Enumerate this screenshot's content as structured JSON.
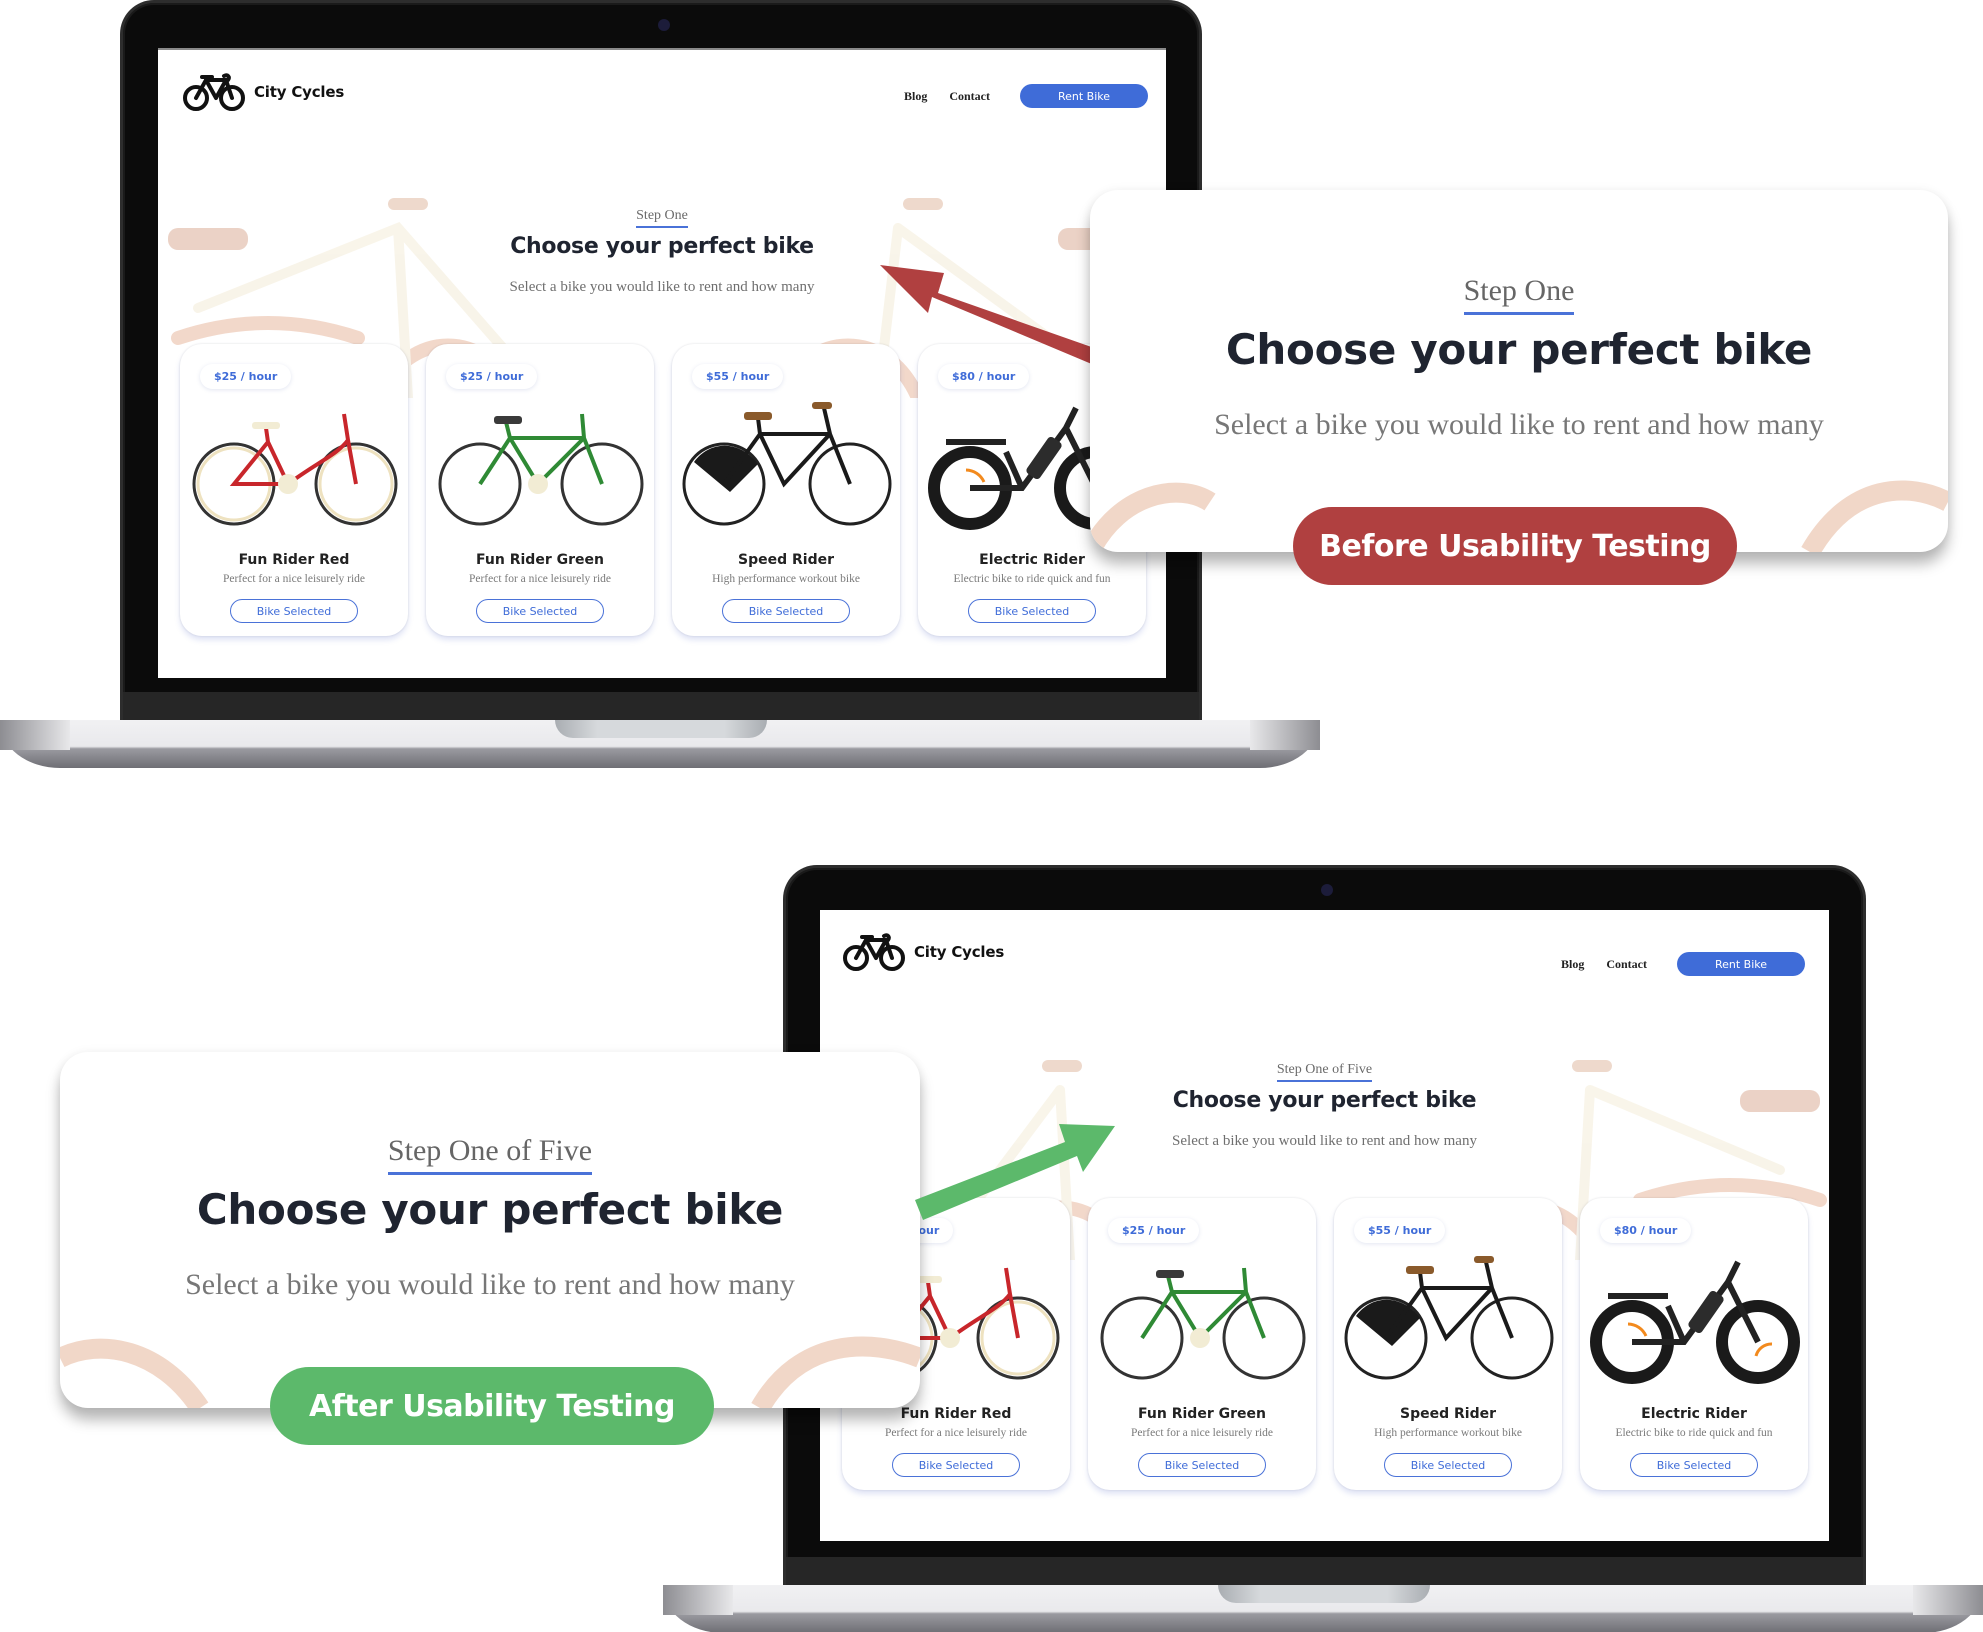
{
  "colors": {
    "brand_blue": "#3f6cd8",
    "before_red": "#b04040",
    "after_green": "#5cb96b",
    "heading": "#1f2430"
  },
  "site": {
    "logo_icon": "bicycle-icon",
    "brand_name": "City Cycles",
    "nav": {
      "blog": "Blog",
      "contact": "Contact",
      "rent_button": "Rent Bike"
    },
    "title": "Choose your perfect bike",
    "subtitle": "Select a bike you would like to rent and how many",
    "cards": [
      {
        "price": "$25 / hour",
        "name": "Fun Rider Red",
        "description": "Perfect for a nice leisurely ride",
        "button": "Bike Selected",
        "frame_color": "#c8262b",
        "image": "red-bike-image"
      },
      {
        "price": "$25 / hour",
        "name": "Fun Rider Green",
        "description": "Perfect for a nice leisurely ride",
        "button": "Bike Selected",
        "frame_color": "#2f8a35",
        "image": "green-bike-image"
      },
      {
        "price": "$55 / hour",
        "name": "Speed Rider",
        "description": "High performance workout bike",
        "button": "Bike Selected",
        "frame_color": "#1a1a1a",
        "image": "black-bike-image"
      },
      {
        "price": "$80 / hour",
        "name": "Electric Rider",
        "description": "Electric bike to ride quick and fun",
        "button": "Bike Selected",
        "frame_color": "#222222",
        "image": "electric-bike-image"
      }
    ]
  },
  "before": {
    "step_label": "Step One",
    "title": "Choose your perfect bike",
    "subtitle": "Select a bike you would like to rent and how many",
    "tag": "Before Usability Testing"
  },
  "after": {
    "step_label": "Step One of Five",
    "title": "Choose your perfect bike",
    "subtitle": "Select a bike you would like to rent and how many",
    "tag": "After Usability Testing"
  }
}
